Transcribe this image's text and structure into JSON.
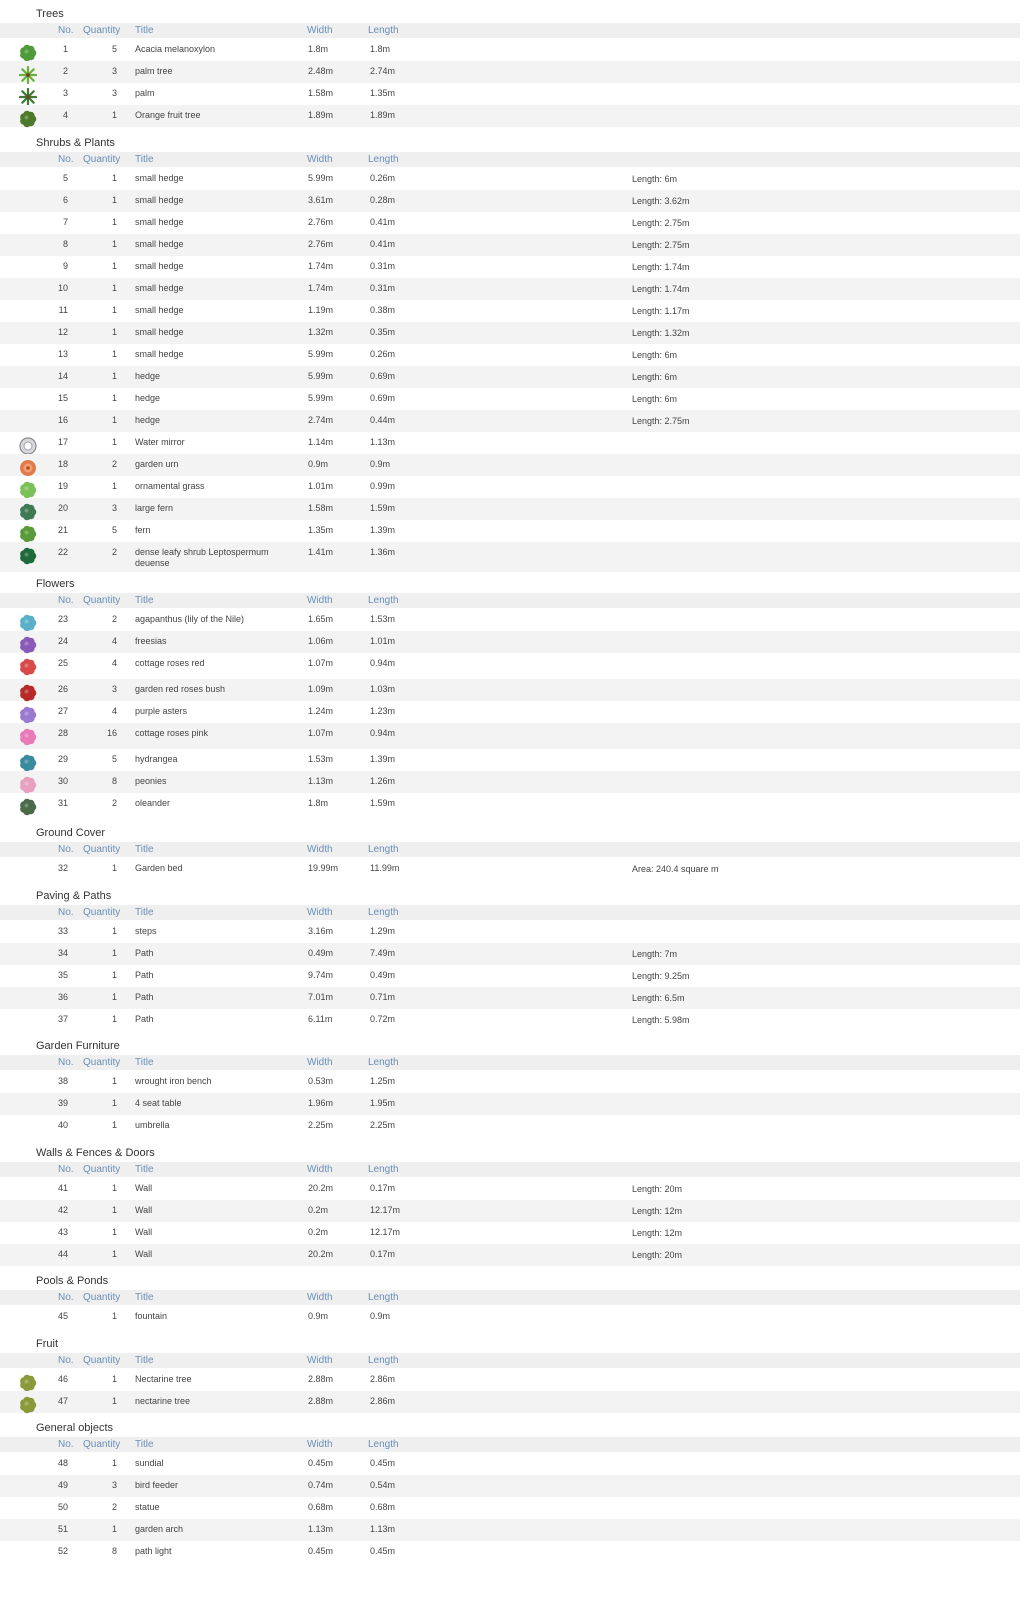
{
  "columns": {
    "no": "No.",
    "qty": "Quantity",
    "title": "Title",
    "width": "Width",
    "length": "Length"
  },
  "sections": [
    {
      "title": "Trees",
      "rows": [
        {
          "no": "1",
          "qty": "5",
          "title": "Acacia melanoxylon",
          "w": "1.8m",
          "l": "1.8m",
          "note": "",
          "icon": "tree-round-icon",
          "color": "#4f9a3a"
        },
        {
          "no": "2",
          "qty": "3",
          "title": "palm tree",
          "w": "2.48m",
          "l": "2.74m",
          "note": "",
          "icon": "palm-star-icon",
          "color": "#6bb03a"
        },
        {
          "no": "3",
          "qty": "3",
          "title": "palm",
          "w": "1.58m",
          "l": "1.35m",
          "note": "",
          "icon": "palm-icon",
          "color": "#3f7a35"
        },
        {
          "no": "4",
          "qty": "1",
          "title": "Orange fruit tree",
          "w": "1.89m",
          "l": "1.89m",
          "note": "",
          "icon": "fruit-tree-icon",
          "color": "#4c7a2a"
        }
      ]
    },
    {
      "title": "Shrubs & Plants",
      "rows": [
        {
          "no": "5",
          "qty": "1",
          "title": "small hedge",
          "w": "5.99m",
          "l": "0.26m",
          "note": "Length: 6m"
        },
        {
          "no": "6",
          "qty": "1",
          "title": "small hedge",
          "w": "3.61m",
          "l": "0.28m",
          "note": "Length: 3.62m"
        },
        {
          "no": "7",
          "qty": "1",
          "title": "small hedge",
          "w": "2.76m",
          "l": "0.41m",
          "note": "Length: 2.75m"
        },
        {
          "no": "8",
          "qty": "1",
          "title": "small hedge",
          "w": "2.76m",
          "l": "0.41m",
          "note": "Length: 2.75m"
        },
        {
          "no": "9",
          "qty": "1",
          "title": "small hedge",
          "w": "1.74m",
          "l": "0.31m",
          "note": "Length: 1.74m"
        },
        {
          "no": "10",
          "qty": "1",
          "title": "small hedge",
          "w": "1.74m",
          "l": "0.31m",
          "note": "Length: 1.74m"
        },
        {
          "no": "11",
          "qty": "1",
          "title": "small hedge",
          "w": "1.19m",
          "l": "0.38m",
          "note": "Length: 1.17m"
        },
        {
          "no": "12",
          "qty": "1",
          "title": "small hedge",
          "w": "1.32m",
          "l": "0.35m",
          "note": "Length: 1.32m"
        },
        {
          "no": "13",
          "qty": "1",
          "title": "small hedge",
          "w": "5.99m",
          "l": "0.26m",
          "note": "Length: 6m"
        },
        {
          "no": "14",
          "qty": "1",
          "title": "hedge",
          "w": "5.99m",
          "l": "0.69m",
          "note": "Length: 6m"
        },
        {
          "no": "15",
          "qty": "1",
          "title": "hedge",
          "w": "5.99m",
          "l": "0.69m",
          "note": "Length: 6m"
        },
        {
          "no": "16",
          "qty": "1",
          "title": "hedge",
          "w": "2.74m",
          "l": "0.44m",
          "note": "Length: 2.75m"
        },
        {
          "no": "17",
          "qty": "1",
          "title": "Water mirror",
          "w": "1.14m",
          "l": "1.13m",
          "note": "",
          "icon": "water-mirror-icon",
          "color": "#b8b8c0"
        },
        {
          "no": "18",
          "qty": "2",
          "title": "garden urn",
          "w": "0.9m",
          "l": "0.9m",
          "note": "",
          "icon": "garden-urn-icon",
          "color": "#e07a4a"
        },
        {
          "no": "19",
          "qty": "1",
          "title": "ornamental grass",
          "w": "1.01m",
          "l": "0.99m",
          "note": "",
          "icon": "grass-icon",
          "color": "#7cc05a"
        },
        {
          "no": "20",
          "qty": "3",
          "title": "large fern",
          "w": "1.58m",
          "l": "1.59m",
          "note": "",
          "icon": "large-fern-icon",
          "color": "#3f7a55"
        },
        {
          "no": "21",
          "qty": "5",
          "title": "fern",
          "w": "1.35m",
          "l": "1.39m",
          "note": "",
          "icon": "fern-icon",
          "color": "#5a9a3a"
        },
        {
          "no": "22",
          "qty": "2",
          "title": "dense leafy shrub Leptospermum deuense",
          "w": "1.41m",
          "l": "1.36m",
          "note": "",
          "icon": "leafy-shrub-icon",
          "color": "#1f6a3a"
        }
      ]
    },
    {
      "title": "Flowers",
      "rows": [
        {
          "no": "23",
          "qty": "2",
          "title": "agapanthus (lily of the Nile)",
          "w": "1.65m",
          "l": "1.53m",
          "note": "",
          "icon": "agapanthus-icon",
          "color": "#5ab0c8"
        },
        {
          "no": "24",
          "qty": "4",
          "title": "freesias",
          "w": "1.06m",
          "l": "1.01m",
          "note": "",
          "icon": "freesia-icon",
          "color": "#8a5ab8"
        },
        {
          "no": "25",
          "qty": "4",
          "title": "cottage roses red",
          "w": "1.07m",
          "l": "0.94m",
          "note": "",
          "icon": "red-roses-icon",
          "color": "#d84a4a"
        },
        {
          "no": "26",
          "qty": "3",
          "title": "garden red roses bush",
          "w": "1.09m",
          "l": "1.03m",
          "note": "",
          "icon": "rose-bush-icon",
          "color": "#b82a2a"
        },
        {
          "no": "27",
          "qty": "4",
          "title": "purple asters",
          "w": "1.24m",
          "l": "1.23m",
          "note": "",
          "icon": "aster-icon",
          "color": "#9a7ad0"
        },
        {
          "no": "28",
          "qty": "16",
          "title": "cottage roses pink",
          "w": "1.07m",
          "l": "0.94m",
          "note": "",
          "icon": "pink-roses-icon",
          "color": "#e87ab8"
        },
        {
          "no": "29",
          "qty": "5",
          "title": "hydrangea",
          "w": "1.53m",
          "l": "1.39m",
          "note": "",
          "icon": "hydrangea-icon",
          "color": "#3a8aa0"
        },
        {
          "no": "30",
          "qty": "8",
          "title": "peonies",
          "w": "1.13m",
          "l": "1.26m",
          "note": "",
          "icon": "peony-icon",
          "color": "#e8a0c0"
        },
        {
          "no": "31",
          "qty": "2",
          "title": "oleander",
          "w": "1.8m",
          "l": "1.59m",
          "note": "",
          "icon": "oleander-icon",
          "color": "#4a6a4a"
        }
      ]
    },
    {
      "title": "Ground Cover",
      "rows": [
        {
          "no": "32",
          "qty": "1",
          "title": "Garden bed",
          "w": "19.99m",
          "l": "11.99m",
          "note": "Area: 240.4 square m"
        }
      ]
    },
    {
      "title": "Paving & Paths",
      "rows": [
        {
          "no": "33",
          "qty": "1",
          "title": "steps",
          "w": "3.16m",
          "l": "1.29m",
          "note": ""
        },
        {
          "no": "34",
          "qty": "1",
          "title": "Path",
          "w": "0.49m",
          "l": "7.49m",
          "note": "Length: 7m"
        },
        {
          "no": "35",
          "qty": "1",
          "title": "Path",
          "w": "9.74m",
          "l": "0.49m",
          "note": "Length: 9.25m"
        },
        {
          "no": "36",
          "qty": "1",
          "title": "Path",
          "w": "7.01m",
          "l": "0.71m",
          "note": "Length: 6.5m"
        },
        {
          "no": "37",
          "qty": "1",
          "title": "Path",
          "w": "6.11m",
          "l": "0.72m",
          "note": "Length: 5.98m"
        }
      ]
    },
    {
      "title": "Garden Furniture",
      "rows": [
        {
          "no": "38",
          "qty": "1",
          "title": "wrought iron bench",
          "w": "0.53m",
          "l": "1.25m",
          "note": ""
        },
        {
          "no": "39",
          "qty": "1",
          "title": "4 seat table",
          "w": "1.96m",
          "l": "1.95m",
          "note": ""
        },
        {
          "no": "40",
          "qty": "1",
          "title": "umbrella",
          "w": "2.25m",
          "l": "2.25m",
          "note": ""
        }
      ]
    },
    {
      "title": "Walls & Fences & Doors",
      "rows": [
        {
          "no": "41",
          "qty": "1",
          "title": "Wall",
          "w": "20.2m",
          "l": "0.17m",
          "note": "Length: 20m"
        },
        {
          "no": "42",
          "qty": "1",
          "title": "Wall",
          "w": "0.2m",
          "l": "12.17m",
          "note": "Length: 12m"
        },
        {
          "no": "43",
          "qty": "1",
          "title": "Wall",
          "w": "0.2m",
          "l": "12.17m",
          "note": "Length: 12m"
        },
        {
          "no": "44",
          "qty": "1",
          "title": "Wall",
          "w": "20.2m",
          "l": "0.17m",
          "note": "Length: 20m"
        }
      ]
    },
    {
      "title": "Pools & Ponds",
      "rows": [
        {
          "no": "45",
          "qty": "1",
          "title": "fountain",
          "w": "0.9m",
          "l": "0.9m",
          "note": ""
        }
      ]
    },
    {
      "title": "Fruit",
      "rows": [
        {
          "no": "46",
          "qty": "1",
          "title": "Nectarine tree",
          "w": "2.88m",
          "l": "2.86m",
          "note": "",
          "icon": "nectarine-tree-icon",
          "color": "#8a9a3a"
        },
        {
          "no": "47",
          "qty": "1",
          "title": "nectarine tree",
          "w": "2.88m",
          "l": "2.86m",
          "note": "",
          "icon": "nectarine-tree-icon",
          "color": "#8a9a3a"
        }
      ]
    },
    {
      "title": "General objects",
      "rows": [
        {
          "no": "48",
          "qty": "1",
          "title": "sundial",
          "w": "0.45m",
          "l": "0.45m",
          "note": ""
        },
        {
          "no": "49",
          "qty": "3",
          "title": "bird feeder",
          "w": "0.74m",
          "l": "0.54m",
          "note": ""
        },
        {
          "no": "50",
          "qty": "2",
          "title": "statue",
          "w": "0.68m",
          "l": "0.68m",
          "note": ""
        },
        {
          "no": "51",
          "qty": "1",
          "title": "garden arch",
          "w": "1.13m",
          "l": "1.13m",
          "note": ""
        },
        {
          "no": "52",
          "qty": "8",
          "title": "path light",
          "w": "0.45m",
          "l": "0.45m",
          "note": ""
        }
      ]
    }
  ]
}
